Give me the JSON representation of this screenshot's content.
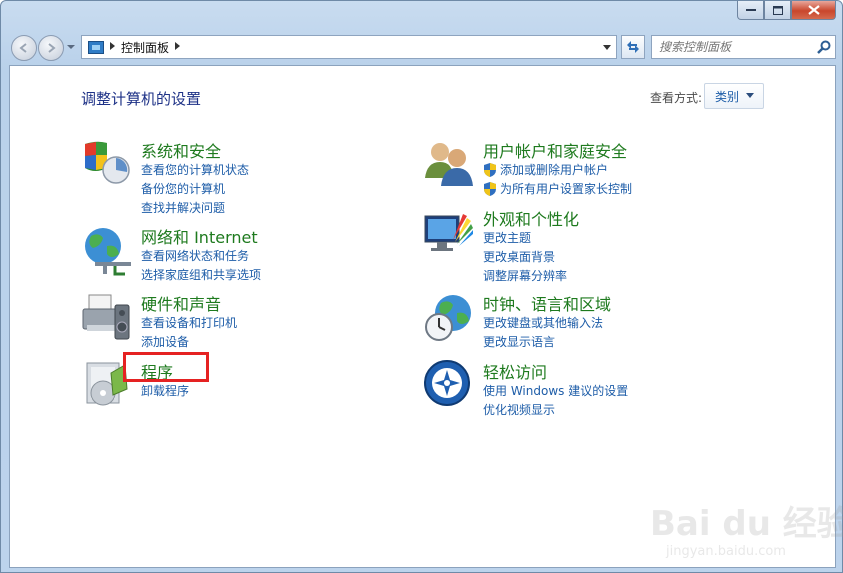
{
  "window": {
    "minimize": "0",
    "maximize": "1",
    "close": "x"
  },
  "nav": {
    "breadcrumb": "控制面板",
    "search_placeholder": "搜索控制面板"
  },
  "header": {
    "title": "调整计算机的设置",
    "view_label": "查看方式:",
    "view_value": "类别"
  },
  "categories": [
    {
      "title": "系统和安全",
      "links": [
        "查看您的计算机状态",
        "备份您的计算机",
        "查找并解决问题"
      ],
      "icon": "system-security-icon"
    },
    {
      "title": "网络和 Internet",
      "links": [
        "查看网络状态和任务",
        "选择家庭组和共享选项"
      ],
      "icon": "network-internet-icon"
    },
    {
      "title": "硬件和声音",
      "links": [
        "查看设备和打印机",
        "添加设备"
      ],
      "icon": "hardware-sound-icon"
    },
    {
      "title": "程序",
      "links": [
        "卸载程序"
      ],
      "icon": "programs-icon"
    },
    {
      "title": "用户帐户和家庭安全",
      "links": [
        "添加或删除用户帐户",
        "为所有用户设置家长控制"
      ],
      "icon": "user-accounts-icon"
    },
    {
      "title": "外观和个性化",
      "links": [
        "更改主题",
        "更改桌面背景",
        "调整屏幕分辨率"
      ],
      "icon": "appearance-icon"
    },
    {
      "title": "时钟、语言和区域",
      "links": [
        "更改键盘或其他输入法",
        "更改显示语言"
      ],
      "icon": "clock-language-icon"
    },
    {
      "title": "轻松访问",
      "links": [
        "使用 Windows 建议的设置",
        "优化视频显示"
      ],
      "icon": "ease-of-access-icon"
    }
  ],
  "watermark": {
    "brand": "Bai du 经验",
    "url": "jingyan.baidu.com"
  },
  "colors": {
    "title_blue": "#1e3287",
    "category_green": "#1e7a1e",
    "link_blue": "#1e5da8",
    "highlight_red": "#e52222"
  }
}
